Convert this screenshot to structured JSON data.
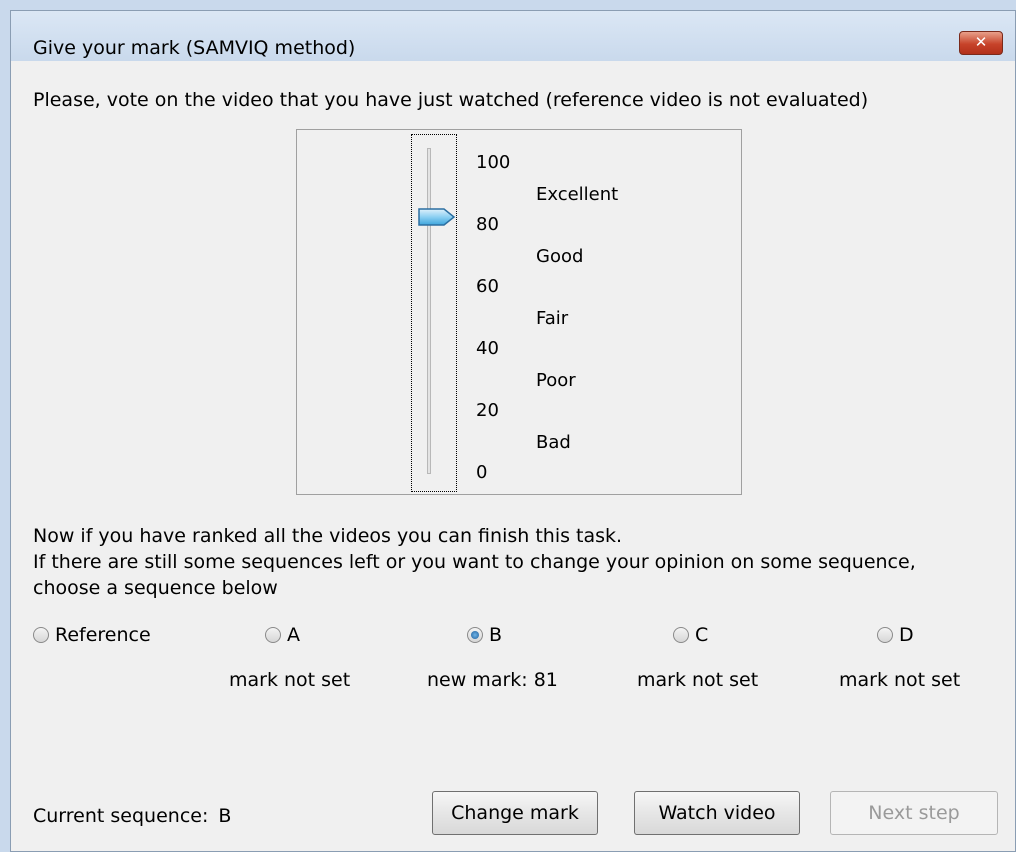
{
  "window": {
    "title": "Give your mark (SAMVIQ method)",
    "close_glyph": "✕"
  },
  "instruction": "Please, vote on the video that you have just watched (reference video is not evaluated)",
  "slider": {
    "current_value": 81,
    "min": 0,
    "max": 100,
    "ticks": [
      "100",
      "80",
      "60",
      "40",
      "20",
      "0"
    ],
    "quality_labels": [
      "Excellent",
      "Good",
      "Fair",
      "Poor",
      "Bad"
    ]
  },
  "messages": {
    "line1": "Now if you have ranked all the videos you can finish this task.",
    "line2": "If there are still some sequences left or you want to change your opinion on some sequence,",
    "line3": "choose a sequence below"
  },
  "sequences": [
    {
      "label": "Reference",
      "checked": false,
      "status": ""
    },
    {
      "label": "A",
      "checked": false,
      "status": "mark not set"
    },
    {
      "label": "B",
      "checked": true,
      "status": "new mark: 81"
    },
    {
      "label": "C",
      "checked": false,
      "status": "mark not set"
    },
    {
      "label": "D",
      "checked": false,
      "status": "mark not set"
    }
  ],
  "current_sequence": {
    "label": "Current sequence:",
    "value": "B"
  },
  "buttons": {
    "change_mark": "Change mark",
    "watch_video": "Watch video",
    "next_step": "Next step"
  },
  "colors": {
    "accent": "#1f5f9c",
    "close": "#c7432a"
  }
}
